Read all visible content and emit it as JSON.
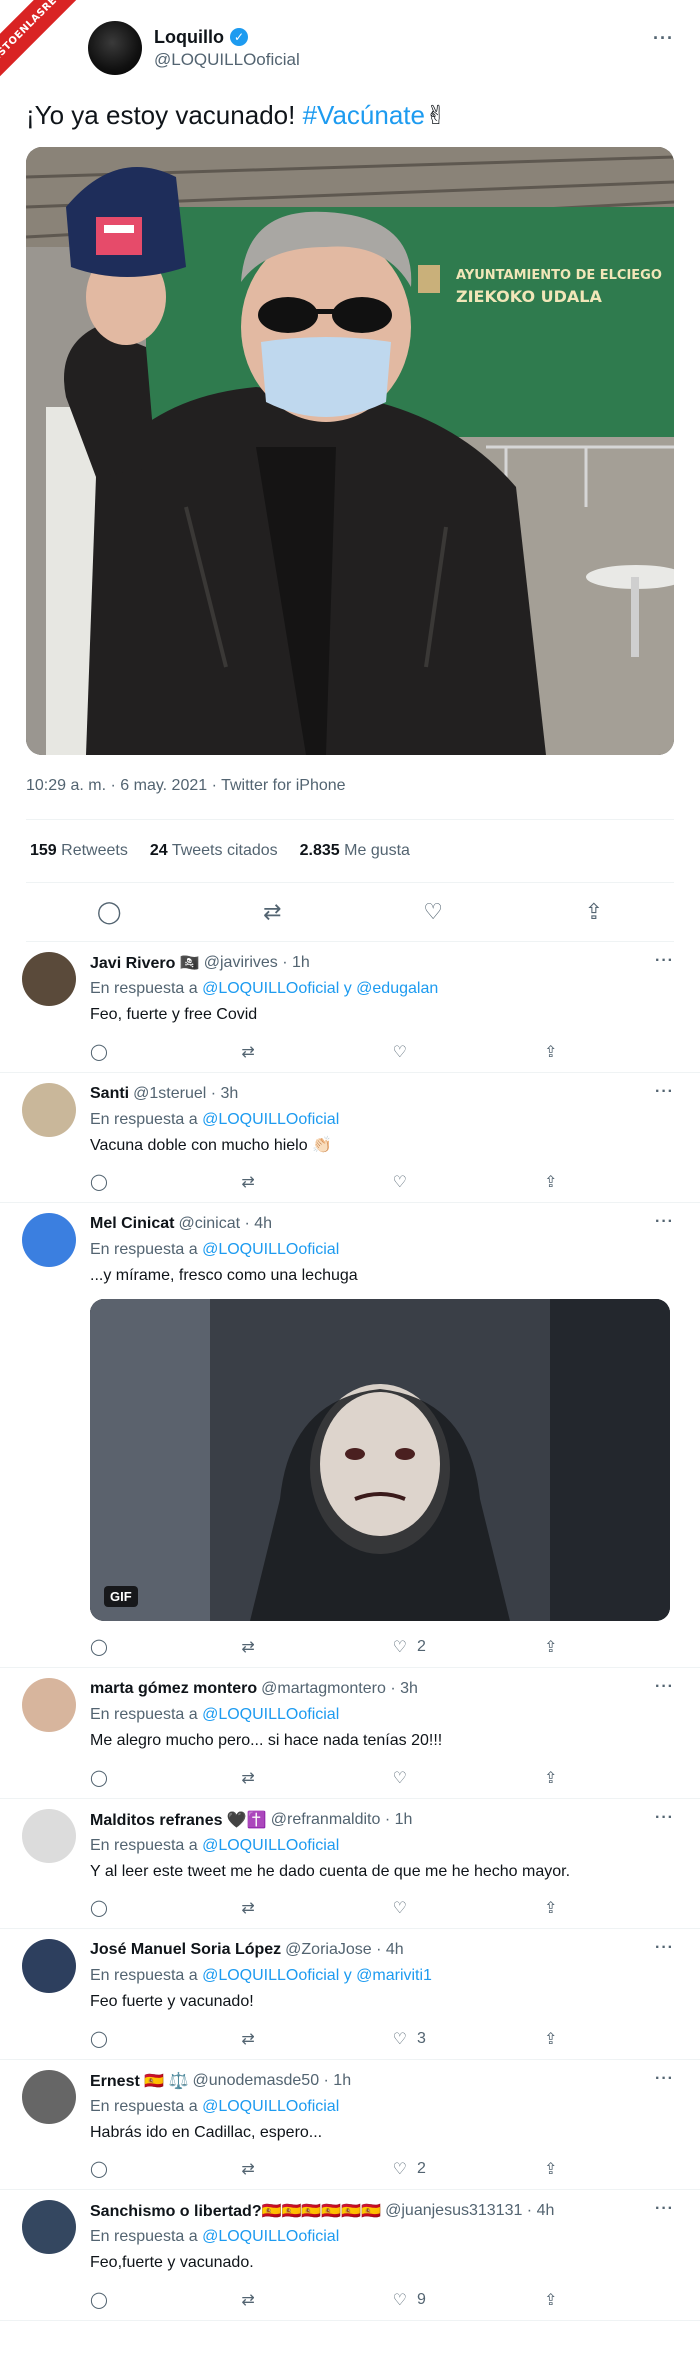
{
  "badge": "VISTOENLASREDES",
  "main_tweet": {
    "author_name": "Loquillo",
    "handle": "@LOQUILLOoficial",
    "text_plain": "¡Yo ya estoy vacunado!",
    "hashtag": "#Vacúnate",
    "emoji": "✌",
    "photo_sign_line1": "AYUNTAMIENTO DE ELCIEGO",
    "photo_sign_line2": "ZIEKOKO UDALA",
    "meta": "10:29 a. m. · 6 may. 2021 · Twitter for iPhone",
    "stats": [
      {
        "value": "159",
        "label": "Retweets"
      },
      {
        "value": "24",
        "label": "Tweets citados"
      },
      {
        "value": "2.835",
        "label": "Me gusta"
      }
    ]
  },
  "icons": {
    "reply": "💬",
    "retweet": "⇄",
    "like": "♡",
    "share": "⇪",
    "more": "···"
  },
  "replies": [
    {
      "name": "Javi Rivero 🏴‍☠️",
      "handle": "@javirives · 1h",
      "replyto_prefix": "En respuesta a",
      "replyto": "@LOQUILLOoficial y @edugalan",
      "text": "Feo, fuerte y free Covid",
      "likes": "",
      "avatar": "#5a4a3a"
    },
    {
      "name": "Santi",
      "handle": "@1steruel · 3h",
      "replyto_prefix": "En respuesta a",
      "replyto": "@LOQUILLOoficial",
      "text": "Vacuna doble con mucho hielo 👏🏻",
      "likes": "",
      "avatar": "#c9b79a"
    },
    {
      "name": "Mel Cinicat",
      "handle": "@cinicat · 4h",
      "replyto_prefix": "En respuesta a",
      "replyto": "@LOQUILLOoficial",
      "text": "...y mírame, fresco como una lechuga",
      "likes": "2",
      "avatar": "#3b7fe0",
      "gif_label": "GIF"
    },
    {
      "name": "marta gómez montero",
      "handle": "@martagmontero · 3h",
      "replyto_prefix": "En respuesta a",
      "replyto": "@LOQUILLOoficial",
      "text": "Me alegro mucho pero... si hace nada tenías 20!!!",
      "likes": "",
      "avatar": "#d7b59d"
    },
    {
      "name": "Malditos refranes 🖤✝️",
      "handle": "@refranmaldito · 1h",
      "replyto_prefix": "En respuesta a",
      "replyto": "@LOQUILLOoficial",
      "text": "Y al leer este tweet me he dado cuenta de que me he hecho mayor.",
      "likes": "",
      "avatar": "#dcdcdc"
    },
    {
      "name": "José Manuel Soria López",
      "handle": "@ZoriaJose · 4h",
      "replyto_prefix": "En respuesta a",
      "replyto": "@LOQUILLOoficial y @mariviti1",
      "text": "Feo fuerte y vacunado!",
      "likes": "3",
      "avatar": "#2d3f5e"
    },
    {
      "name": "Ernest 🇪🇸 ⚖️",
      "handle": "@unodemasde50 · 1h",
      "replyto_prefix": "En respuesta a",
      "replyto": "@LOQUILLOoficial",
      "text": "Habrás ido en Cadillac, espero...",
      "likes": "2",
      "avatar": "#666666"
    },
    {
      "name": "Sanchismo o libertad?🇪🇸🇪🇸🇪🇸🇪🇸🇪🇸🇪🇸",
      "handle": "@juanjesus313131 · 4h",
      "replyto_prefix": "En respuesta a",
      "replyto": "@LOQUILLOoficial",
      "text": "Feo,fuerte y vacunado.",
      "likes": "9",
      "avatar": "#344760"
    }
  ]
}
